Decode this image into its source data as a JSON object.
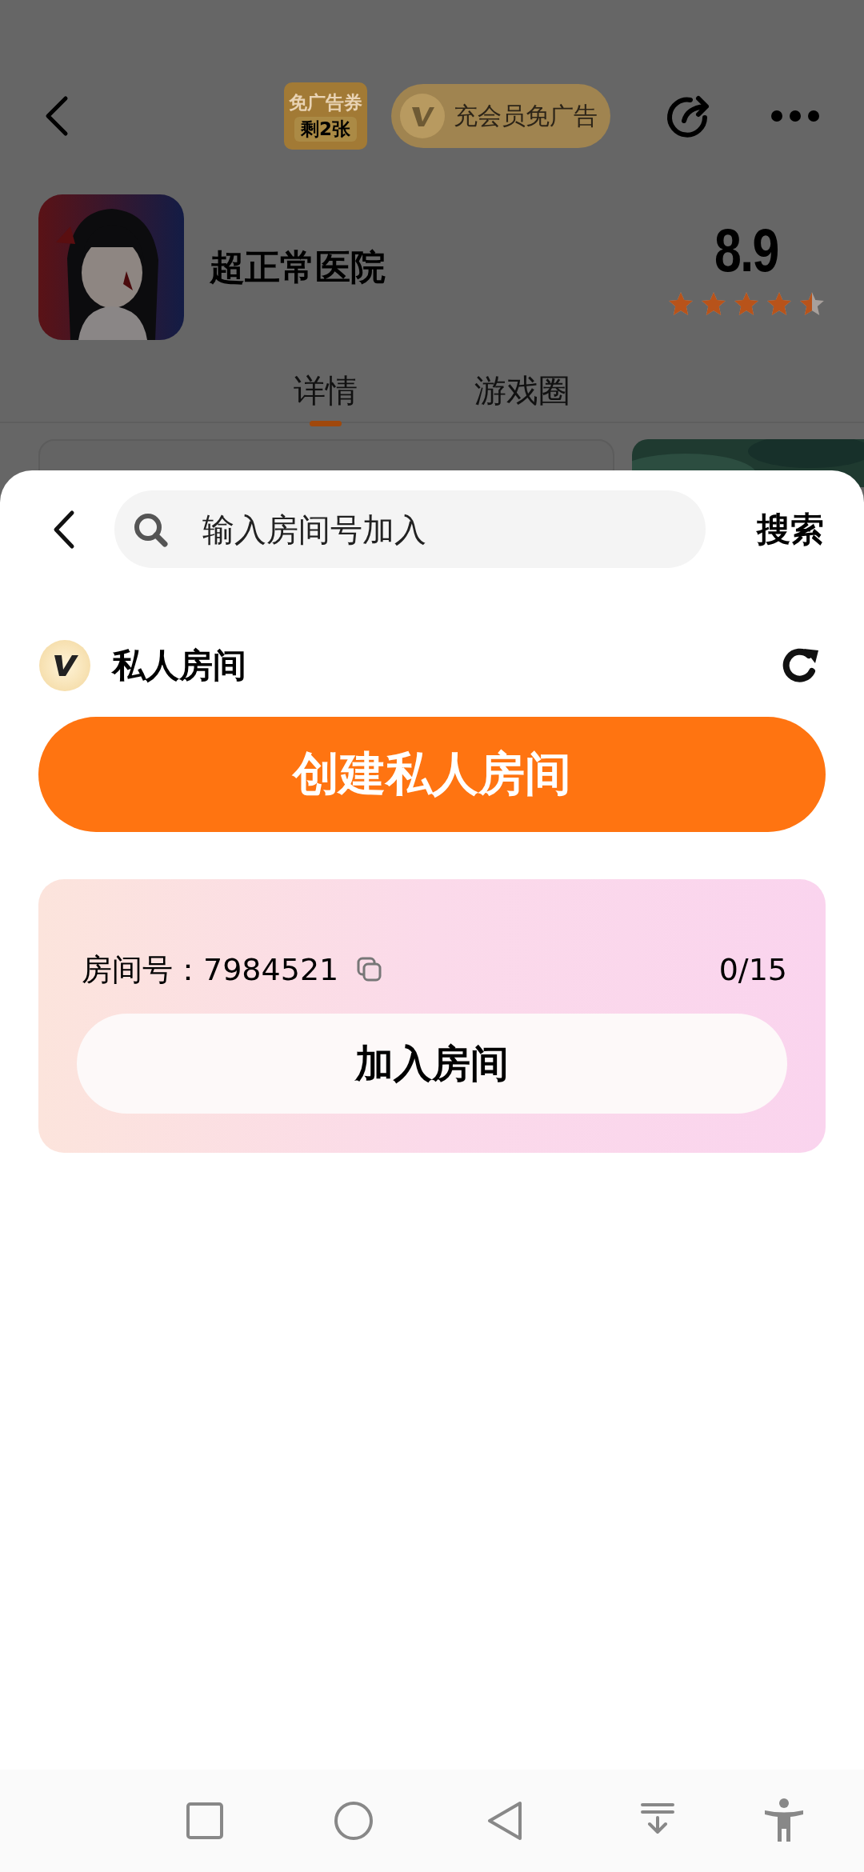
{
  "header": {
    "voucher": {
      "line_1": "免广告券",
      "line_2": "剩2张"
    },
    "vip_button": "充会员免广告"
  },
  "game": {
    "title": "超正常医院",
    "rating": "8.9",
    "stars": 4.5
  },
  "tabs": [
    {
      "label": "详情",
      "selected": true
    },
    {
      "label": "游戏圈",
      "selected": false
    }
  ],
  "sheet": {
    "search": {
      "placeholder": "输入房间号加入"
    },
    "search_button": "搜索",
    "section_title": "私人房间",
    "create_button": "创建私人房间",
    "room": {
      "room_number": "房间号：7984521",
      "member_count": "0/15",
      "join_button": "加入房间"
    }
  }
}
